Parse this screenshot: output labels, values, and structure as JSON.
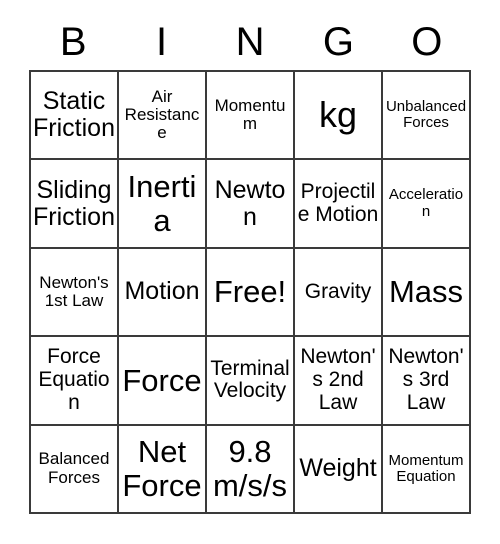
{
  "card": {
    "title": "BINGO",
    "header": {
      "letters": [
        "B",
        "I",
        "N",
        "G",
        "O"
      ]
    },
    "colors": {
      "background": "#ffffff",
      "border": "#3a3a3a",
      "text": "#000000"
    },
    "grid": {
      "rows": 5,
      "columns": 5,
      "free_space_index": 12,
      "cells": [
        {
          "text": "Static Friction",
          "size": "l"
        },
        {
          "text": "Air Resistance",
          "size": "s"
        },
        {
          "text": "Momentum",
          "size": "s"
        },
        {
          "text": "kg",
          "size": "xxl"
        },
        {
          "text": "Unbalanced Forces",
          "size": "xs"
        },
        {
          "text": "Sliding Friction",
          "size": "l"
        },
        {
          "text": "Inertia",
          "size": "xl"
        },
        {
          "text": "Newton",
          "size": "l"
        },
        {
          "text": "Projectile Motion",
          "size": "m"
        },
        {
          "text": "Acceleration",
          "size": "xs"
        },
        {
          "text": "Newton's 1st Law",
          "size": "s"
        },
        {
          "text": "Motion",
          "size": "l"
        },
        {
          "text": "Free!",
          "size": "xl"
        },
        {
          "text": "Gravity",
          "size": "m"
        },
        {
          "text": "Mass",
          "size": "xl"
        },
        {
          "text": "Force Equation",
          "size": "m"
        },
        {
          "text": "Force",
          "size": "xl"
        },
        {
          "text": "Terminal Velocity",
          "size": "m"
        },
        {
          "text": "Newton's 2nd Law",
          "size": "m"
        },
        {
          "text": "Newton's 3rd Law",
          "size": "m"
        },
        {
          "text": "Balanced Forces",
          "size": "s"
        },
        {
          "text": "Net Force",
          "size": "xl"
        },
        {
          "text": "9.8 m/s/s",
          "size": "xl"
        },
        {
          "text": "Weight",
          "size": "l"
        },
        {
          "text": "Momentum Equation",
          "size": "xs"
        }
      ]
    }
  }
}
